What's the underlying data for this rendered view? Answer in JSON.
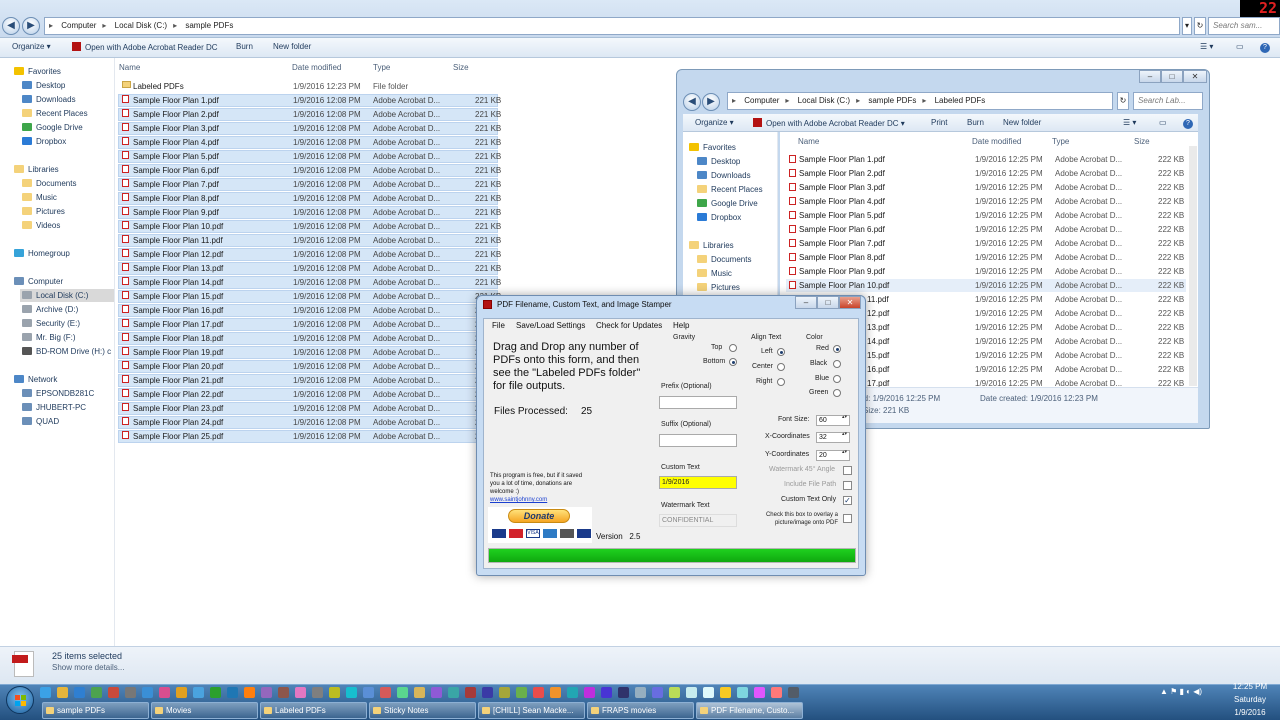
{
  "main_window": {
    "breadcrumb": [
      "Computer",
      "Local Disk (C:)",
      "sample PDFs"
    ],
    "search_placeholder": "Search sam...",
    "toolbar": {
      "organize": "Organize ▾",
      "open_with": "Open with Adobe Acrobat Reader DC",
      "burn": "Burn",
      "new_folder": "New folder"
    },
    "nav": {
      "favorites": "Favorites",
      "favorites_items": [
        "Desktop",
        "Downloads",
        "Recent Places",
        "Google Drive",
        "Dropbox"
      ],
      "libraries": "Libraries",
      "libraries_items": [
        "Documents",
        "Music",
        "Pictures",
        "Videos"
      ],
      "homegroup": "Homegroup",
      "computer": "Computer",
      "computer_items": [
        "Local Disk (C:)",
        "Archive (D:)",
        "Security (E:)",
        "Mr. Big (F:)",
        "BD-ROM Drive (H:) c"
      ],
      "network": "Network",
      "network_items": [
        "EPSONDB281C",
        "JHUBERT-PC",
        "QUAD"
      ]
    },
    "columns": {
      "name": "Name",
      "date": "Date modified",
      "type": "Type",
      "size": "Size"
    },
    "folder_row": {
      "name": "Labeled PDFs",
      "date": "1/9/2016 12:23 PM",
      "type": "File folder",
      "size": ""
    },
    "files": [
      "Sample Floor Plan 1.pdf",
      "Sample Floor Plan 2.pdf",
      "Sample Floor Plan 3.pdf",
      "Sample Floor Plan 4.pdf",
      "Sample Floor Plan 5.pdf",
      "Sample Floor Plan 6.pdf",
      "Sample Floor Plan 7.pdf",
      "Sample Floor Plan 8.pdf",
      "Sample Floor Plan 9.pdf",
      "Sample Floor Plan 10.pdf",
      "Sample Floor Plan 11.pdf",
      "Sample Floor Plan 12.pdf",
      "Sample Floor Plan 13.pdf",
      "Sample Floor Plan 14.pdf",
      "Sample Floor Plan 15.pdf",
      "Sample Floor Plan 16.pdf",
      "Sample Floor Plan 17.pdf",
      "Sample Floor Plan 18.pdf",
      "Sample Floor Plan 19.pdf",
      "Sample Floor Plan 20.pdf",
      "Sample Floor Plan 21.pdf",
      "Sample Floor Plan 22.pdf",
      "Sample Floor Plan 23.pdf",
      "Sample Floor Plan 24.pdf",
      "Sample Floor Plan 25.pdf"
    ],
    "file_date": "1/9/2016 12:08 PM",
    "file_type": "Adobe Acrobat D...",
    "file_size": "221 KB",
    "status": {
      "selected": "25 items selected",
      "details": "Show more details..."
    }
  },
  "second_window": {
    "breadcrumb": [
      "Computer",
      "Local Disk (C:)",
      "sample PDFs",
      "Labeled PDFs"
    ],
    "search_placeholder": "Search Lab...",
    "toolbar": {
      "organize": "Organize ▾",
      "open_with": "Open with Adobe Acrobat Reader DC ▾",
      "print": "Print",
      "burn": "Burn",
      "new_folder": "New folder"
    },
    "nav_favorites": "Favorites",
    "nav_items": [
      "Desktop",
      "Downloads",
      "Recent Places",
      "Google Drive",
      "Dropbox"
    ],
    "nav_libraries": "Libraries",
    "nav_lib_items": [
      "Documents",
      "Music",
      "Pictures"
    ],
    "columns": {
      "name": "Name",
      "date": "Date modified",
      "type": "Type",
      "size": "Size"
    },
    "files": [
      "Sample Floor Plan 1.pdf",
      "Sample Floor Plan 2.pdf",
      "Sample Floor Plan 3.pdf",
      "Sample Floor Plan 4.pdf",
      "Sample Floor Plan 5.pdf",
      "Sample Floor Plan 6.pdf",
      "Sample Floor Plan 7.pdf",
      "Sample Floor Plan 8.pdf",
      "Sample Floor Plan 9.pdf",
      "Sample Floor Plan 10.pdf",
      "Sample Floor Plan 11.pdf",
      "Sample Floor Plan 12.pdf",
      "Sample Floor Plan 13.pdf",
      "Sample Floor Plan 14.pdf",
      "Sample Floor Plan 15.pdf",
      "Sample Floor Plan 16.pdf",
      "Sample Floor Plan 17.pdf"
    ],
    "file_date": "1/9/2016 12:25 PM",
    "file_type": "Adobe Acrobat D...",
    "file_size": "222 KB",
    "status": {
      "modified": "dified: 1/9/2016 12:25 PM",
      "created": "Date created: 1/9/2016 12:23 PM",
      "size": "Size: 221 KB"
    }
  },
  "dialog": {
    "title": "PDF Filename, Custom Text, and Image Stamper",
    "menu": [
      "File",
      "Save/Load Settings",
      "Check for Updates",
      "Help"
    ],
    "instructions": "Drag and Drop any number of PDFs onto this form, and then see the \"Labeled PDFs folder\" for file outputs.",
    "files_processed_label": "Files Processed:",
    "files_processed_value": "25",
    "free_note": "This program is free, but if it saved you a lot of time, donations are welcome :)",
    "link": "www.saintjohnny.com",
    "donate": "Donate",
    "version": "Version   2.5",
    "gravity": {
      "label": "Gravity",
      "top": "Top",
      "bottom": "Bottom"
    },
    "align": {
      "label": "Align Text",
      "left": "Left",
      "center": "Center",
      "right": "Right"
    },
    "color": {
      "label": "Color",
      "red": "Red",
      "black": "Black",
      "blue": "Blue",
      "green": "Green"
    },
    "prefix_label": "Prefix (Optional)",
    "suffix_label": "Suffix (Optional)",
    "custom_text_label": "Custom Text",
    "custom_text_value": "1/9/2016",
    "watermark_label": "Watermark Text",
    "watermark_value": "CONFIDENTIAL",
    "font_size_label": "Font Size:",
    "font_size": "60",
    "x_label": "X-Coordinates",
    "x_value": "32",
    "y_label": "Y-Coordinates",
    "y_value": "20",
    "watermark45": "Watermark 45° Angle",
    "include_path": "Include File Path",
    "custom_text_only": "Custom Text Only",
    "overlay_note": "Check this box to overlay a picture/image onto PDF",
    "progress": 1.0,
    "colors": {
      "progress": "#1fd11f",
      "custom_text_bg": "#ffff00"
    }
  },
  "taskbar": {
    "tasks": [
      "sample PDFs",
      "Movies",
      "Labeled PDFs",
      "Sticky Notes",
      "[CHILL] Sean Macke...",
      "FRAPS movies",
      "PDF Filename, Custo..."
    ],
    "time": "12:25 PM",
    "day": "Saturday",
    "date": "1/9/2016",
    "fraps": "22"
  }
}
